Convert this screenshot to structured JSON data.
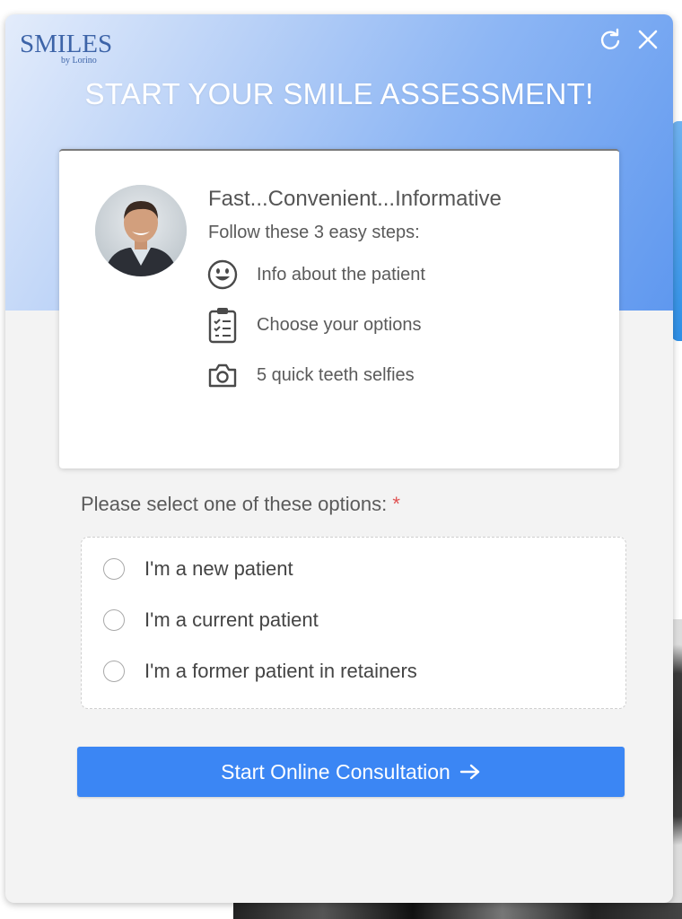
{
  "brand": {
    "logo_main": "SMILES",
    "logo_sub": "by Lorino"
  },
  "header": {
    "title": "START YOUR SMILE ASSESSMENT!",
    "refresh_icon": "refresh-icon",
    "close_icon": "close-icon"
  },
  "intro": {
    "heading": "Fast...Convenient...Informative",
    "subheading": "Follow these 3 easy steps:",
    "steps": [
      {
        "label": "Info about the patient",
        "icon": "smiley-icon"
      },
      {
        "label": "Choose your options",
        "icon": "clipboard-icon"
      },
      {
        "label": "5 quick teeth selfies",
        "icon": "camera-icon"
      }
    ]
  },
  "form": {
    "question": "Please select one of these options:",
    "required_mark": "*",
    "options": [
      {
        "label": "I'm a new patient",
        "selected": false
      },
      {
        "label": "I'm a current patient",
        "selected": false
      },
      {
        "label": "I'm a former patient in retainers",
        "selected": false
      }
    ]
  },
  "cta": {
    "label": "Start Online Consultation",
    "icon": "arrow-right-icon"
  },
  "colors": {
    "accent": "#3b86f4",
    "required": "#e05252",
    "logo": "#3d64a8"
  }
}
